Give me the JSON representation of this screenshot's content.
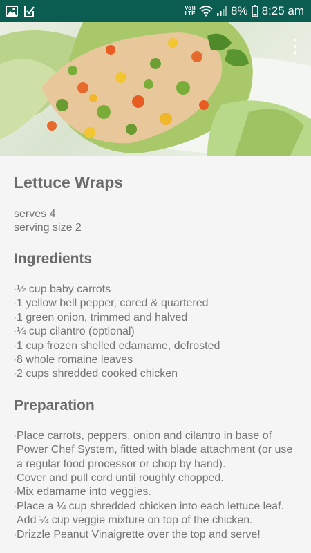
{
  "status_bar": {
    "volte_line1": "Vo))",
    "volte_line2": "LTE",
    "battery_percent": "8%",
    "time": "8:25 am",
    "icons": [
      "gallery-icon",
      "download-icon",
      "volte-icon",
      "wifi-icon",
      "signal-icon",
      "battery-icon"
    ]
  },
  "recipe": {
    "title": "Lettuce Wraps",
    "serves": "serves 4",
    "serving_size": "serving size 2",
    "ingredients_heading": "Ingredients",
    "ingredients": [
      "½ cup baby carrots",
      "1 yellow bell pepper, cored & quartered",
      "1 green onion, trimmed and halved",
      "¼ cup cilantro (optional)",
      "1 cup frozen shelled edamame, defrosted",
      "8 whole romaine leaves",
      "2 cups shredded cooked chicken"
    ],
    "preparation_heading": "Preparation",
    "preparation": [
      "Place carrots, peppers, onion and cilantro in base of Power Chef System, fitted with blade attachment (or use a regular food processor or chop by hand).",
      "Cover and pull cord until roughly chopped.",
      "Mix edamame into veggies.",
      "Place a ¼ cup shredded chicken into each lettuce leaf. Add ¼ cup veggie mixture on top of the chicken.",
      "Drizzle Peanut Vinaigrette over the top and serve!"
    ]
  },
  "colors": {
    "status_bar": "#0b5d51",
    "background": "#f5f5f5",
    "text": "#757575"
  }
}
